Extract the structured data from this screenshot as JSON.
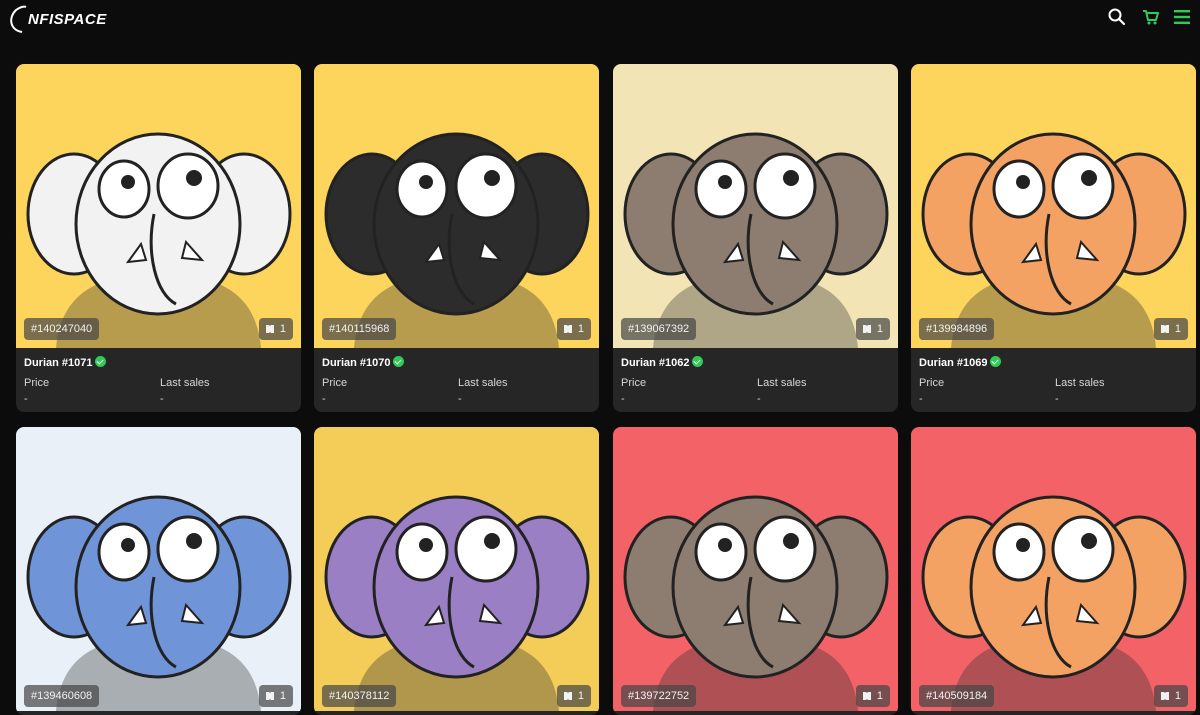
{
  "header": {
    "logo_text": "NFISPACE",
    "icons": [
      "search-icon",
      "cart-icon",
      "menu-icon"
    ],
    "accent": "#2ecc55"
  },
  "labels": {
    "price": "Price",
    "last_sales": "Last sales"
  },
  "cards": [
    {
      "name": "Durian #1071",
      "token_id": "#140247040",
      "editions": "1",
      "price": "-",
      "last_sales": "-",
      "bg": "#fdd55c",
      "body": "#f2f2f2"
    },
    {
      "name": "Durian #1070",
      "token_id": "#140115968",
      "editions": "1",
      "price": "-",
      "last_sales": "-",
      "bg": "#fdd55c",
      "body": "#2c2c2c"
    },
    {
      "name": "Durian #1062",
      "token_id": "#139067392",
      "editions": "1",
      "price": "-",
      "last_sales": "-",
      "bg": "#f2e4b4",
      "body": "#8d7d70"
    },
    {
      "name": "Durian #1069",
      "token_id": "#139984896",
      "editions": "1",
      "price": "-",
      "last_sales": "-",
      "bg": "#fdd55c",
      "body": "#f4a263"
    },
    {
      "name": "",
      "token_id": "#139460608",
      "editions": "1",
      "bg": "#e9f0f7",
      "body": "#6f94d8"
    },
    {
      "name": "",
      "token_id": "#140378112",
      "editions": "1",
      "bg": "#f3cd58",
      "body": "#9a7fc4"
    },
    {
      "name": "",
      "token_id": "#139722752",
      "editions": "1",
      "bg": "#f26266",
      "body": "#8d7d70"
    },
    {
      "name": "",
      "token_id": "#140509184",
      "editions": "1",
      "bg": "#f26266",
      "body": "#f4a263"
    }
  ]
}
